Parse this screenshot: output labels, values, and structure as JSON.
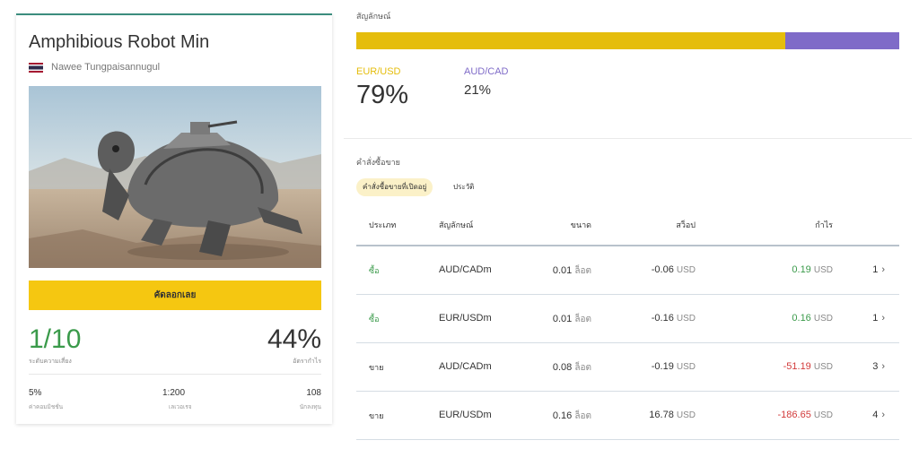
{
  "card": {
    "title": "Amphibious Robot Min",
    "author": "Nawee Tungpaisannugul",
    "copy_button": "คัดลอกเลย",
    "risk_value": "1/10",
    "risk_label": "ระดับความเสี่ยง",
    "profit_value": "44%",
    "profit_label": "อัตรากำไร",
    "stats": [
      {
        "value": "5%",
        "label": "ค่าคอมมิชชั่น"
      },
      {
        "value": "1:200",
        "label": "เลเวอเรจ"
      },
      {
        "value": "108",
        "label": "นักลงทุน"
      }
    ]
  },
  "symbols": {
    "title": "สัญลักษณ์",
    "pair_a": {
      "name": "EUR/USD",
      "percent": "79%",
      "share": 0.79,
      "color": "#e5bd0c"
    },
    "pair_b": {
      "name": "AUD/CAD",
      "percent": "21%",
      "share": 0.21,
      "color": "#7f6bc8"
    }
  },
  "orders": {
    "title": "คำสั่งซื้อขาย",
    "tabs": {
      "open": "คำสั่งซื้อขายที่เปิดอยู่",
      "history": "ประวัติ"
    },
    "columns": {
      "type": "ประเภท",
      "symbol": "สัญลักษณ์",
      "volume": "ขนาด",
      "swap": "สว็อป",
      "profit": "กำไร"
    },
    "units": {
      "lot": "ล็อต",
      "usd": "USD"
    },
    "rows": [
      {
        "type": "ซื้อ",
        "symbol": "AUD/CADm",
        "volume": "0.01",
        "swap": "-0.06",
        "profit": "0.19",
        "count": "1"
      },
      {
        "type": "ซื้อ",
        "symbol": "EUR/USDm",
        "volume": "0.01",
        "swap": "-0.16",
        "profit": "0.16",
        "count": "1"
      },
      {
        "type": "ขาย",
        "symbol": "AUD/CADm",
        "volume": "0.08",
        "swap": "-0.19",
        "profit": "-51.19",
        "count": "3"
      },
      {
        "type": "ขาย",
        "symbol": "EUR/USDm",
        "volume": "0.16",
        "swap": "16.78",
        "profit": "-186.65",
        "count": "4"
      }
    ]
  }
}
